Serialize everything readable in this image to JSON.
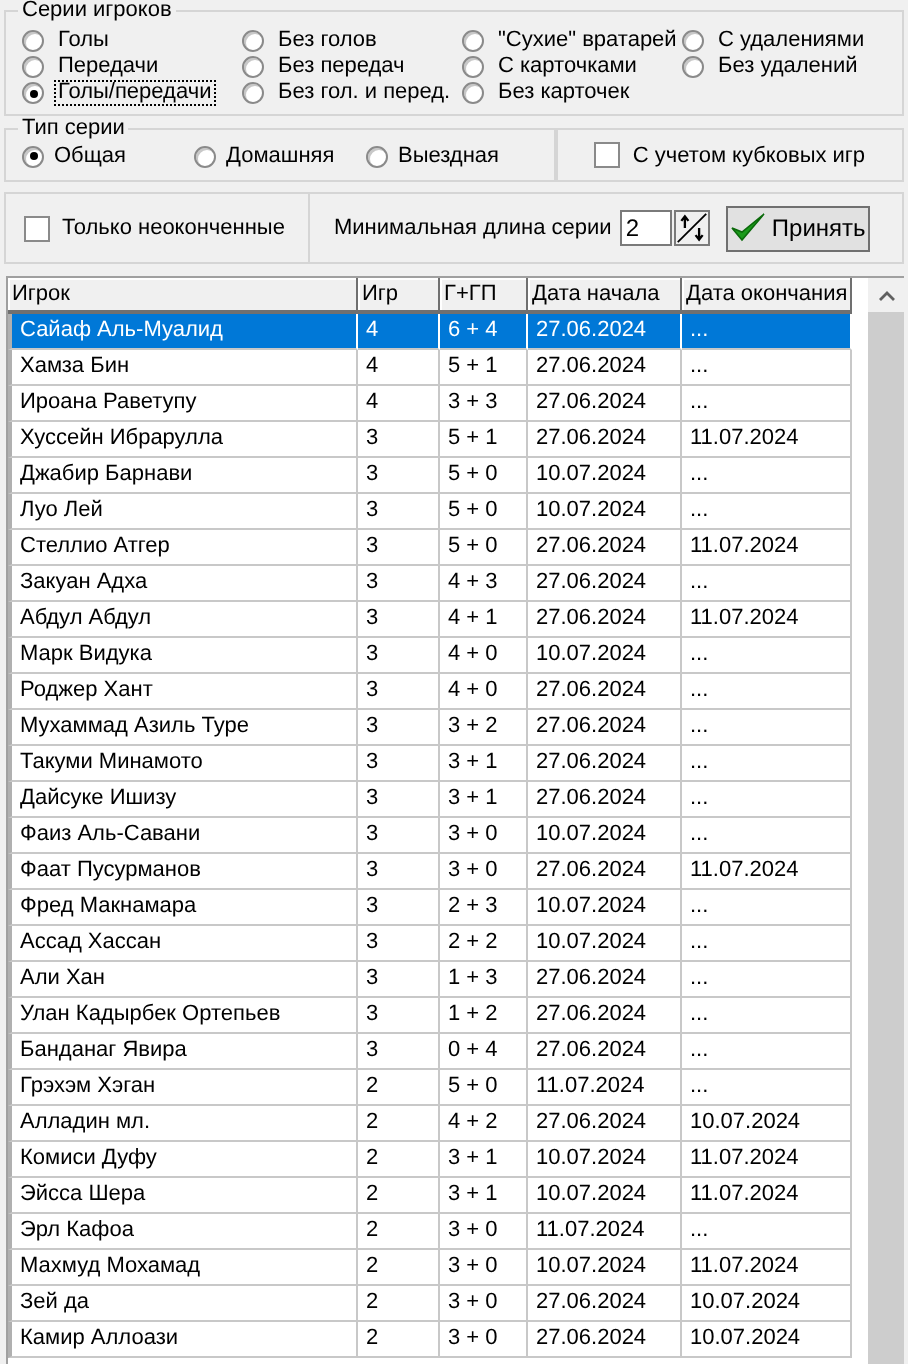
{
  "player_series": {
    "title": "Серии игроков",
    "options": [
      {
        "label": "Голы",
        "selected": false,
        "focused": false
      },
      {
        "label": "Передачи",
        "selected": false,
        "focused": false
      },
      {
        "label": "Голы/передачи",
        "selected": true,
        "focused": true
      },
      {
        "label": "Без голов",
        "selected": false,
        "focused": false
      },
      {
        "label": "Без передач",
        "selected": false,
        "focused": false
      },
      {
        "label": "Без гол. и перед.",
        "selected": false,
        "focused": false
      },
      {
        "label": "\"Сухие\" вратарей",
        "selected": false,
        "focused": false
      },
      {
        "label": "С карточками",
        "selected": false,
        "focused": false
      },
      {
        "label": "Без карточек",
        "selected": false,
        "focused": false
      },
      {
        "label": "С удалениями",
        "selected": false,
        "focused": false
      },
      {
        "label": "Без удалений",
        "selected": false,
        "focused": false
      }
    ]
  },
  "series_type": {
    "title": "Тип серии",
    "options": [
      {
        "label": "Общая",
        "selected": true
      },
      {
        "label": "Домашняя",
        "selected": false
      },
      {
        "label": "Выездная",
        "selected": false
      }
    ]
  },
  "cup_games": {
    "label": "С учетом кубковых игр",
    "checked": false
  },
  "unfinished_only": {
    "label": "Только неоконченные",
    "checked": false
  },
  "min_length": {
    "label": "Минимальная длина серии",
    "value": "2"
  },
  "apply_button": {
    "label": "Принять"
  },
  "table": {
    "columns": [
      "Игрок",
      "Игр",
      "Г+ГП",
      "Дата начала",
      "Дата окончания"
    ],
    "rows": [
      {
        "cells": [
          "Сайаф Аль-Муалид",
          "4",
          "6 + 4",
          "27.06.2024",
          "..."
        ],
        "selected": true
      },
      {
        "cells": [
          "Хамза Бин",
          "4",
          "5 + 1",
          "27.06.2024",
          "..."
        ],
        "selected": false
      },
      {
        "cells": [
          "Ироана Раветупу",
          "4",
          "3 + 3",
          "27.06.2024",
          "..."
        ],
        "selected": false
      },
      {
        "cells": [
          "Хуссейн Ибрарулла",
          "3",
          "5 + 1",
          "27.06.2024",
          "11.07.2024"
        ],
        "selected": false
      },
      {
        "cells": [
          "Джабир Барнави",
          "3",
          "5 + 0",
          "10.07.2024",
          "..."
        ],
        "selected": false
      },
      {
        "cells": [
          "Луо Лей",
          "3",
          "5 + 0",
          "10.07.2024",
          "..."
        ],
        "selected": false
      },
      {
        "cells": [
          "Стеллио Атгер",
          "3",
          "5 + 0",
          "27.06.2024",
          "11.07.2024"
        ],
        "selected": false
      },
      {
        "cells": [
          "Закуан Адха",
          "3",
          "4 + 3",
          "27.06.2024",
          "..."
        ],
        "selected": false
      },
      {
        "cells": [
          "Абдул Абдул",
          "3",
          "4 + 1",
          "27.06.2024",
          "11.07.2024"
        ],
        "selected": false
      },
      {
        "cells": [
          "Марк Видука",
          "3",
          "4 + 0",
          "10.07.2024",
          "..."
        ],
        "selected": false
      },
      {
        "cells": [
          "Роджер Хант",
          "3",
          "4 + 0",
          "27.06.2024",
          "..."
        ],
        "selected": false
      },
      {
        "cells": [
          "Мухаммад Азиль Туре",
          "3",
          "3 + 2",
          "27.06.2024",
          "..."
        ],
        "selected": false
      },
      {
        "cells": [
          "Такуми Минамото",
          "3",
          "3 + 1",
          "27.06.2024",
          "..."
        ],
        "selected": false
      },
      {
        "cells": [
          "Дайсуке Ишизу",
          "3",
          "3 + 1",
          "27.06.2024",
          "..."
        ],
        "selected": false
      },
      {
        "cells": [
          "Фаиз Аль-Савани",
          "3",
          "3 + 0",
          "10.07.2024",
          "..."
        ],
        "selected": false
      },
      {
        "cells": [
          "Фаат Пусурманов",
          "3",
          "3 + 0",
          "27.06.2024",
          "11.07.2024"
        ],
        "selected": false
      },
      {
        "cells": [
          "Фред Макнамара",
          "3",
          "2 + 3",
          "10.07.2024",
          "..."
        ],
        "selected": false
      },
      {
        "cells": [
          "Ассад Хассан",
          "3",
          "2 + 2",
          "10.07.2024",
          "..."
        ],
        "selected": false
      },
      {
        "cells": [
          "Али Хан",
          "3",
          "1 + 3",
          "27.06.2024",
          "..."
        ],
        "selected": false
      },
      {
        "cells": [
          "Улан Кадырбек Ортепьев",
          "3",
          "1 + 2",
          "27.06.2024",
          "..."
        ],
        "selected": false
      },
      {
        "cells": [
          "Банданаг Явира",
          "3",
          "0 + 4",
          "27.06.2024",
          "..."
        ],
        "selected": false
      },
      {
        "cells": [
          "Грэхэм Хэган",
          "2",
          "5 + 0",
          "11.07.2024",
          "..."
        ],
        "selected": false
      },
      {
        "cells": [
          "Алладин мл.",
          "2",
          "4 + 2",
          "27.06.2024",
          "10.07.2024"
        ],
        "selected": false
      },
      {
        "cells": [
          "Комиси Дуфу",
          "2",
          "3 + 1",
          "10.07.2024",
          "11.07.2024"
        ],
        "selected": false
      },
      {
        "cells": [
          "Эйсса Шера",
          "2",
          "3 + 1",
          "10.07.2024",
          "11.07.2024"
        ],
        "selected": false
      },
      {
        "cells": [
          "Эрл Кафоа",
          "2",
          "3 + 0",
          "11.07.2024",
          "..."
        ],
        "selected": false
      },
      {
        "cells": [
          "Махмуд Мохамад",
          "2",
          "3 + 0",
          "10.07.2024",
          "11.07.2024"
        ],
        "selected": false
      },
      {
        "cells": [
          "Зей да",
          "2",
          "3 + 0",
          "27.06.2024",
          "10.07.2024"
        ],
        "selected": false
      },
      {
        "cells": [
          "Камир Аллоази",
          "2",
          "3 + 0",
          "27.06.2024",
          "10.07.2024"
        ],
        "selected": false
      }
    ]
  }
}
